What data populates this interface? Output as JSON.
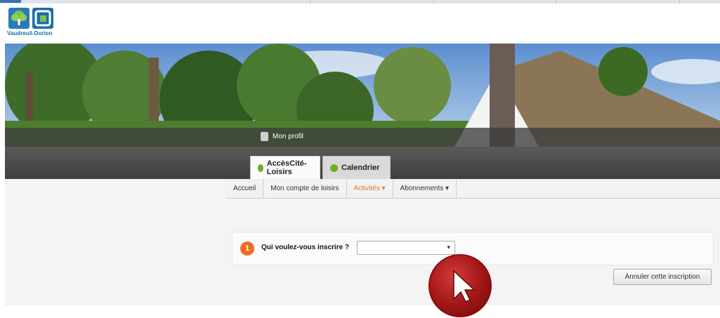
{
  "logo": {
    "text": "Vaudreuil-Dorion"
  },
  "profile": {
    "label": "Mon profil"
  },
  "tabs": [
    {
      "label": "AccèsCité-Loisirs",
      "active": true
    },
    {
      "label": "Calendrier",
      "active": false
    }
  ],
  "menu": [
    {
      "label": "Accueil"
    },
    {
      "label": "Mon compte de loisirs"
    },
    {
      "label": "Activités ▾",
      "highlighted": true
    },
    {
      "label": "Abonnements ▾"
    }
  ],
  "step": {
    "number": "1",
    "question": "Qui voulez-vous inscrire ?",
    "select_value": "",
    "select_arrow": "▾"
  },
  "cancel_button": {
    "label": "Annuler cette inscription"
  },
  "colors": {
    "accent_orange": "#ef6c22",
    "tab_green": "#6ab023",
    "cursor_red": "#a01515"
  }
}
